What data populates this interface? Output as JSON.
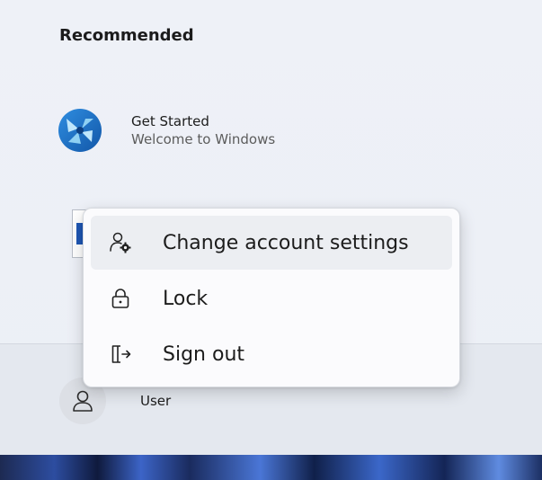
{
  "recommended": {
    "title": "Recommended",
    "items": [
      {
        "name": "Get Started",
        "description": "Welcome to Windows",
        "icon": "get-started-icon"
      }
    ]
  },
  "user": {
    "name": "User",
    "icon": "person-icon"
  },
  "context_menu": {
    "items": [
      {
        "label": "Change account settings",
        "icon": "account-settings-icon",
        "hovered": true
      },
      {
        "label": "Lock",
        "icon": "lock-icon",
        "hovered": false
      },
      {
        "label": "Sign out",
        "icon": "sign-out-icon",
        "hovered": false
      }
    ]
  },
  "colors": {
    "accent": "#1f57b4",
    "icon_blue": "#1e6fc9",
    "icon_light": "#9fd6f5"
  }
}
